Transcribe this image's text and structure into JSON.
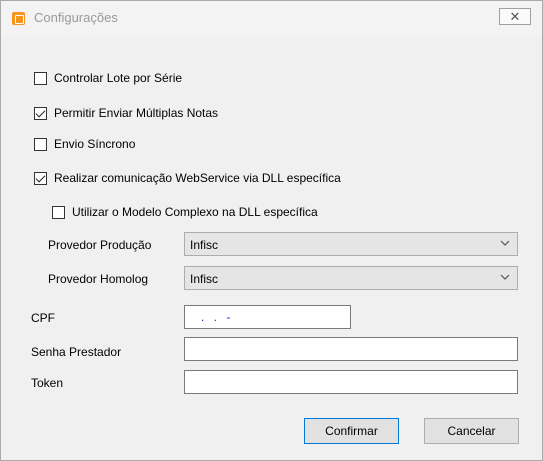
{
  "window": {
    "title": "Configurações",
    "close_label": "✕"
  },
  "options": [
    {
      "label": "Controlar Lote por Série",
      "checked": false
    },
    {
      "label": "Permitir Enviar Múltiplas Notas",
      "checked": true
    },
    {
      "label": "Envio Síncrono",
      "checked": false
    },
    {
      "label": "Realizar comunicação WebService via DLL específica",
      "checked": true
    },
    {
      "label": "Utilizar o Modelo Complexo na DLL específica",
      "checked": false
    }
  ],
  "provedor_producao": {
    "label": "Provedor Produção",
    "value": "Infisc"
  },
  "provedor_homolog": {
    "label": "Provedor Homolog",
    "value": "Infisc"
  },
  "cpf": {
    "label": "CPF",
    "value": " .  .  -"
  },
  "senha": {
    "label": "Senha Prestador",
    "value": ""
  },
  "token": {
    "label": "Token",
    "value": ""
  },
  "buttons": {
    "confirm": "Confirmar",
    "cancel": "Cancelar"
  }
}
